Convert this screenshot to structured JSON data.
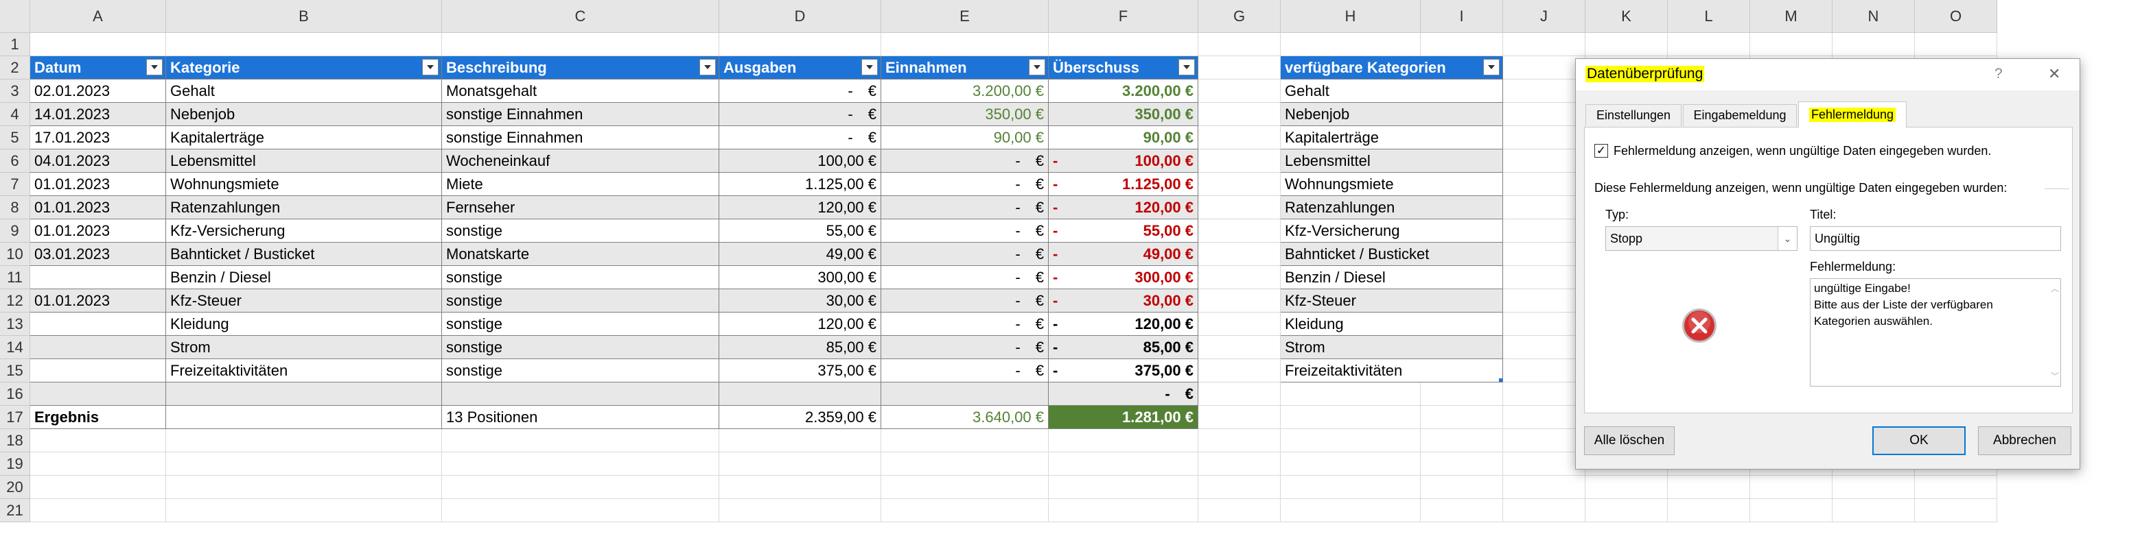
{
  "columns": [
    "A",
    "B",
    "C",
    "D",
    "E",
    "F",
    "G",
    "H",
    "I",
    "J",
    "K",
    "L",
    "M",
    "N",
    "O"
  ],
  "rows": [
    "1",
    "2",
    "3",
    "4",
    "5",
    "6",
    "7",
    "8",
    "9",
    "10",
    "11",
    "12",
    "13",
    "14",
    "15",
    "16",
    "17",
    "18",
    "19",
    "20",
    "21"
  ],
  "table": {
    "headers": [
      "Datum",
      "Kategorie",
      "Beschreibung",
      "Ausgaben",
      "Einnahmen",
      "Überschuss"
    ],
    "rows": [
      {
        "datum": "02.01.2023",
        "kategorie": "Gehalt",
        "beschreibung": "Monatsgehalt",
        "ausgaben": "-",
        "einnahmen": "3.200,00 €",
        "ueberschuss": "3.200,00 €",
        "neg": false
      },
      {
        "datum": "14.01.2023",
        "kategorie": "Nebenjob",
        "beschreibung": "sonstige Einnahmen",
        "ausgaben": "-",
        "einnahmen": "350,00 €",
        "ueberschuss": "350,00 €",
        "neg": false
      },
      {
        "datum": "17.01.2023",
        "kategorie": "Kapitalerträge",
        "beschreibung": "sonstige Einnahmen",
        "ausgaben": "-",
        "einnahmen": "90,00 €",
        "ueberschuss": "90,00 €",
        "neg": false
      },
      {
        "datum": "04.01.2023",
        "kategorie": "Lebensmittel",
        "beschreibung": "Wocheneinkauf",
        "ausgaben": "100,00 €",
        "einnahmen": "-",
        "ueberschuss": "100,00 €",
        "neg": true
      },
      {
        "datum": "01.01.2023",
        "kategorie": "Wohnungsmiete",
        "beschreibung": "Miete",
        "ausgaben": "1.125,00 €",
        "einnahmen": "-",
        "ueberschuss": "1.125,00 €",
        "neg": true
      },
      {
        "datum": "01.01.2023",
        "kategorie": "Ratenzahlungen",
        "beschreibung": "Fernseher",
        "ausgaben": "120,00 €",
        "einnahmen": "-",
        "ueberschuss": "120,00 €",
        "neg": true
      },
      {
        "datum": "01.01.2023",
        "kategorie": "Kfz-Versicherung",
        "beschreibung": "sonstige",
        "ausgaben": "55,00 €",
        "einnahmen": "-",
        "ueberschuss": "55,00 €",
        "neg": true
      },
      {
        "datum": "03.01.2023",
        "kategorie": "Bahnticket / Busticket",
        "beschreibung": "Monatskarte",
        "ausgaben": "49,00 €",
        "einnahmen": "-",
        "ueberschuss": "49,00 €",
        "neg": true
      },
      {
        "datum": "",
        "kategorie": "Benzin / Diesel",
        "beschreibung": "sonstige",
        "ausgaben": "300,00 €",
        "einnahmen": "-",
        "ueberschuss": "300,00 €",
        "neg": true
      },
      {
        "datum": "01.01.2023",
        "kategorie": "Kfz-Steuer",
        "beschreibung": "sonstige",
        "ausgaben": "30,00 €",
        "einnahmen": "-",
        "ueberschuss": "30,00 €",
        "neg": true
      },
      {
        "datum": "",
        "kategorie": "Kleidung",
        "beschreibung": "sonstige",
        "ausgaben": "120,00 €",
        "einnahmen": "-",
        "ueberschuss": "120,00 €",
        "neg": "black"
      },
      {
        "datum": "",
        "kategorie": "Strom",
        "beschreibung": "sonstige",
        "ausgaben": "85,00 €",
        "einnahmen": "-",
        "ueberschuss": "85,00 €",
        "neg": "black"
      },
      {
        "datum": "",
        "kategorie": "Freizeitaktivitäten",
        "beschreibung": "sonstige",
        "ausgaben": "375,00 €",
        "einnahmen": "-",
        "ueberschuss": "375,00 €",
        "neg": "black"
      },
      {
        "datum": "",
        "kategorie": "",
        "beschreibung": "",
        "ausgaben": "",
        "einnahmen": "",
        "ueberschuss": "-",
        "neg": "empty"
      }
    ],
    "dash_symbol": "-",
    "euro_symbol": "€",
    "result": {
      "label": "Ergebnis",
      "positions": "13 Positionen",
      "ausgaben": "2.359,00 €",
      "einnahmen": "3.640,00 €",
      "ueberschuss": "1.281,00 €"
    }
  },
  "categories": {
    "header": "verfügbare Kategorien",
    "items": [
      "Gehalt",
      "Nebenjob",
      "Kapitalerträge",
      "Lebensmittel",
      "Wohnungsmiete",
      "Ratenzahlungen",
      "Kfz-Versicherung",
      "Bahnticket / Busticket",
      "Benzin / Diesel",
      "Kfz-Steuer",
      "Kleidung",
      "Strom",
      "Freizeitaktivitäten"
    ]
  },
  "dialog": {
    "title": "Datenüberprüfung",
    "help": "?",
    "close": "✕",
    "tabs": [
      "Einstellungen",
      "Eingabemeldung",
      "Fehlermeldung"
    ],
    "active_tab": "Fehlermeldung",
    "checkbox_label": "Fehlermeldung anzeigen, wenn ungültige Daten eingegeben wurden.",
    "checkbox_checked": true,
    "section_label": "Diese Fehlermeldung anzeigen, wenn ungültige Daten eingegeben wurden:",
    "type_label": "Typ:",
    "type_value": "Stopp",
    "title_label": "Titel:",
    "title_value": "Ungültig",
    "message_label": "Fehlermeldung:",
    "message_lines": [
      "ungültige Eingabe!",
      "Bitte aus der Liste der verfügbaren",
      "Kategorien auswählen."
    ],
    "btn_clear": "Alle löschen",
    "btn_ok": "OK",
    "btn_cancel": "Abbrechen",
    "highlight_color": "#ffff00",
    "error_icon": "error-icon"
  },
  "colors": {
    "header_blue": "#1e74d6",
    "green": "#548235",
    "red": "#c00000",
    "result_fill": "#548235"
  }
}
